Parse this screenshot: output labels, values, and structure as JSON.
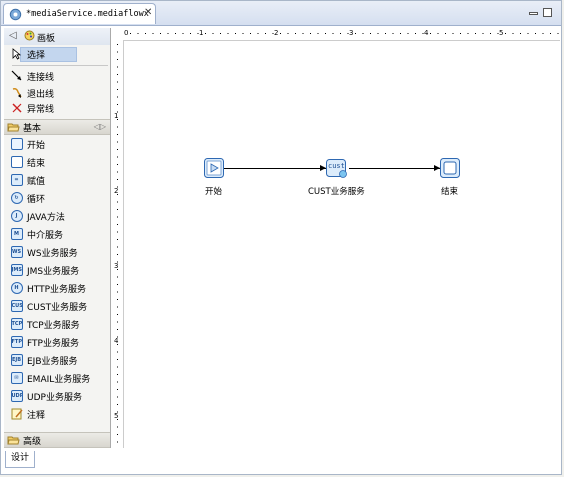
{
  "editor": {
    "tab_title": "*mediaService.mediaflowx",
    "bottom_tab": "设计"
  },
  "palette": {
    "header": "画板",
    "tools": [
      {
        "label": "选择",
        "icon": "arrow-select-icon"
      },
      {
        "label": "连接线",
        "icon": "connection-icon"
      },
      {
        "label": "退出线",
        "icon": "exit-line-icon"
      },
      {
        "label": "异常线",
        "icon": "exception-line-icon"
      }
    ],
    "basic_drawer": "基本",
    "basic_items": [
      {
        "label": "开始",
        "icon": "start-icon"
      },
      {
        "label": "结束",
        "icon": "end-icon"
      },
      {
        "label": "赋值",
        "icon": "assign-icon"
      },
      {
        "label": "循环",
        "icon": "loop-icon"
      },
      {
        "label": "JAVA方法",
        "icon": "java-icon"
      },
      {
        "label": "中介服务",
        "icon": "mediation-service-icon"
      },
      {
        "label": "WS业务服务",
        "icon": "ws-service-icon"
      },
      {
        "label": "JMS业务服务",
        "icon": "jms-service-icon"
      },
      {
        "label": "HTTP业务服务",
        "icon": "http-service-icon"
      },
      {
        "label": "CUST业务服务",
        "icon": "cust-service-icon"
      },
      {
        "label": "TCP业务服务",
        "icon": "tcp-service-icon"
      },
      {
        "label": "FTP业务服务",
        "icon": "ftp-service-icon"
      },
      {
        "label": "EJB业务服务",
        "icon": "ejb-service-icon"
      },
      {
        "label": "EMAIL业务服务",
        "icon": "email-service-icon"
      },
      {
        "label": "UDP业务服务",
        "icon": "udp-service-icon"
      },
      {
        "label": "注释",
        "icon": "note-icon"
      }
    ],
    "advanced_drawer": "高级"
  },
  "ruler": {
    "top_numbers": [
      "0",
      "1",
      "2",
      "3",
      "4",
      "5"
    ],
    "left_numbers": [
      "1",
      "2",
      "3",
      "4",
      "5"
    ]
  },
  "diagram": {
    "nodes": [
      {
        "label": "开始",
        "icon": "start-node-icon"
      },
      {
        "label": "CUST业务服务",
        "icon": "cust-service-node-icon",
        "icon_text": "cust"
      },
      {
        "label": "结束",
        "icon": "end-node-icon"
      }
    ]
  }
}
